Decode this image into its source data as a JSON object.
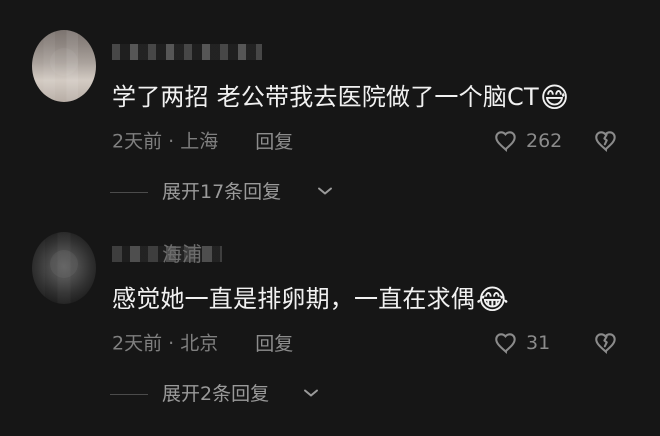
{
  "comments": [
    {
      "username_text": "",
      "text": "学了两招 老公带我去医院做了一个脑CT",
      "emoji": "😅",
      "time": "2天前",
      "separator": "·",
      "location": "上海",
      "reply_label": "回复",
      "likes": "262",
      "replies_label": "展开17条回复"
    },
    {
      "username_text": "海浦",
      "text": "感觉她一直是排卵期，一直在求偶",
      "emoji": "😂",
      "time": "2天前",
      "separator": "·",
      "location": "北京",
      "reply_label": "回复",
      "likes": "31",
      "replies_label": "展开2条回复"
    }
  ],
  "colors": {
    "background": "#161616",
    "primary_text": "#f1f1f1",
    "secondary_text": "#7f7f7f",
    "icon_gray": "#8b8b8b"
  },
  "icons": {
    "like": "heart-icon",
    "dislike": "broken-heart-icon",
    "expand": "chevron-down-icon"
  }
}
